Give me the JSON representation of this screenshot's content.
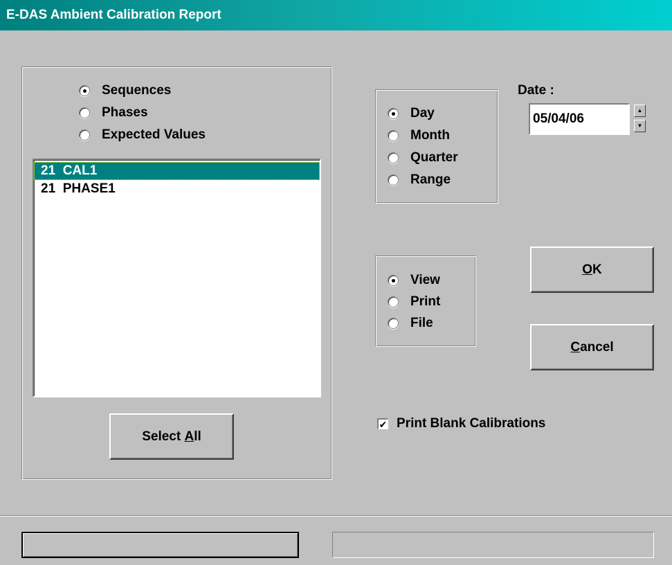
{
  "window": {
    "title": "E-DAS Ambient Calibration Report"
  },
  "report_type": {
    "options": [
      {
        "label": "Sequences",
        "selected": true
      },
      {
        "label": "Phases",
        "selected": false
      },
      {
        "label": "Expected Values",
        "selected": false
      }
    ]
  },
  "list": {
    "items": [
      {
        "text": "21  CAL1",
        "selected": true
      },
      {
        "text": "21  PHASE1",
        "selected": false
      }
    ]
  },
  "select_all": {
    "prefix": "Select ",
    "accel": "A",
    "suffix": "ll"
  },
  "period": {
    "options": [
      {
        "label": "Day",
        "selected": true
      },
      {
        "label": "Month",
        "selected": false
      },
      {
        "label": "Quarter",
        "selected": false
      },
      {
        "label": "Range",
        "selected": false
      }
    ]
  },
  "date": {
    "label": "Date :",
    "value": "05/04/06"
  },
  "output": {
    "options": [
      {
        "label": "View",
        "selected": true
      },
      {
        "label": "Print",
        "selected": false
      },
      {
        "label": "File",
        "selected": false
      }
    ]
  },
  "ok_button": {
    "accel": "O",
    "rest": "K"
  },
  "cancel_button": {
    "accel": "C",
    "rest": "ancel"
  },
  "print_blank": {
    "label": "Print Blank Calibrations",
    "checked": true,
    "check_glyph": "✔"
  },
  "icons": {
    "spin_up": "▲",
    "spin_down": "▼"
  }
}
